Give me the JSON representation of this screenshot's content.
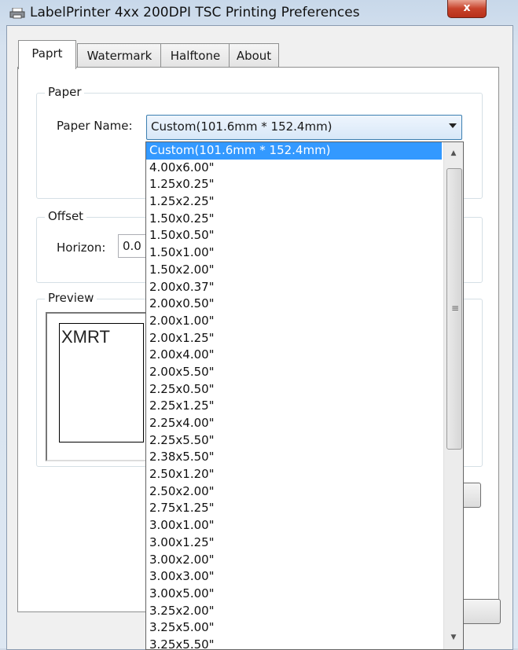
{
  "window": {
    "title": "LabelPrinter 4xx 200DPI TSC Printing Preferences",
    "close_label": "x"
  },
  "tabs": [
    {
      "label": "Paprt",
      "active": true
    },
    {
      "label": "Watermark",
      "active": false
    },
    {
      "label": "Halftone",
      "active": false
    },
    {
      "label": "About",
      "active": false
    }
  ],
  "paper_group": {
    "title": "Paper",
    "paper_name_label": "Paper Name:",
    "paper_name_value": "Custom(101.6mm * 152.4mm)"
  },
  "offset_group": {
    "title": "Offset",
    "horizon_label": "Horizon:",
    "horizon_value": "0.0"
  },
  "preview_group": {
    "title": "Preview",
    "preview_text": "XMRT"
  },
  "dropdown": {
    "selected_index": 0,
    "items": [
      "Custom(101.6mm * 152.4mm)",
      "4.00x6.00\"",
      "1.25x0.25\"",
      "1.25x2.25\"",
      "1.50x0.25\"",
      "1.50x0.50\"",
      "1.50x1.00\"",
      "1.50x2.00\"",
      "2.00x0.37\"",
      "2.00x0.50\"",
      "2.00x1.00\"",
      "2.00x1.25\"",
      "2.00x4.00\"",
      "2.00x5.50\"",
      "2.25x0.50\"",
      "2.25x1.25\"",
      "2.25x4.00\"",
      "2.25x5.50\"",
      "2.38x5.50\"",
      "2.50x1.20\"",
      "2.50x2.00\"",
      "2.75x1.25\"",
      "3.00x1.00\"",
      "3.00x1.25\"",
      "3.00x2.00\"",
      "3.00x3.00\"",
      "3.00x5.00\"",
      "3.25x2.00\"",
      "3.25x5.00\"",
      "3.25x5.50\""
    ]
  },
  "colors": {
    "selection": "#3399ff",
    "close_button": "#c7432b"
  },
  "icons": {
    "title_icon": "printer-icon",
    "scroll_up": "scroll-up-arrow-icon",
    "scroll_down": "scroll-down-arrow-icon",
    "combo_arrow": "chevron-down-icon"
  }
}
